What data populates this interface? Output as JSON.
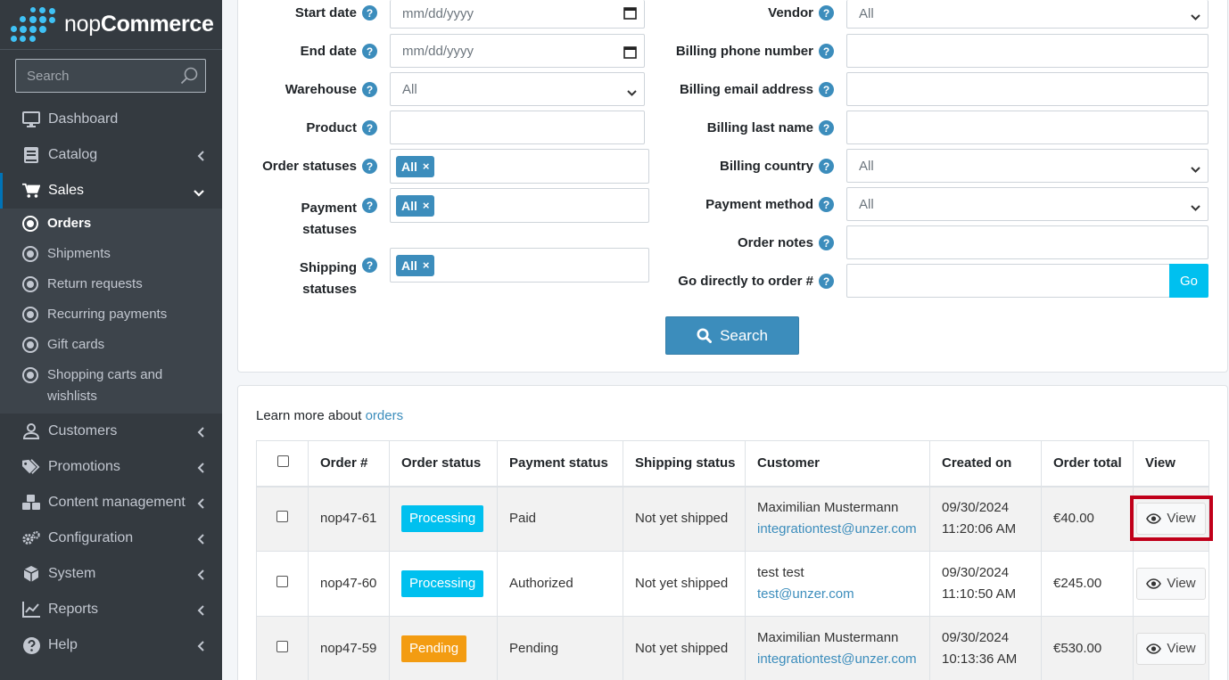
{
  "brand": {
    "prefix": "nop",
    "suffix": "Commerce"
  },
  "sidebar": {
    "search_placeholder": "Search",
    "items": [
      {
        "label": "Dashboard"
      },
      {
        "label": "Catalog"
      },
      {
        "label": "Sales"
      },
      {
        "label": "Customers"
      },
      {
        "label": "Promotions"
      },
      {
        "label": "Content management"
      },
      {
        "label": "Configuration"
      },
      {
        "label": "System"
      },
      {
        "label": "Reports"
      },
      {
        "label": "Help"
      }
    ],
    "sales_sub": [
      {
        "label": "Orders"
      },
      {
        "label": "Shipments"
      },
      {
        "label": "Return requests"
      },
      {
        "label": "Recurring payments"
      },
      {
        "label": "Gift cards"
      },
      {
        "label": "Shopping carts and wishlists"
      }
    ]
  },
  "filters": {
    "left": [
      {
        "label": "Start date",
        "value": "mm/dd/yyyy"
      },
      {
        "label": "End date",
        "value": "mm/dd/yyyy"
      },
      {
        "label": "Warehouse",
        "value": "All"
      },
      {
        "label": "Product",
        "value": ""
      },
      {
        "label": "Order statuses",
        "value": "All"
      },
      {
        "label": "Payment statuses",
        "value": "All"
      },
      {
        "label": "Shipping statuses",
        "value": "All"
      }
    ],
    "right": [
      {
        "label": "Vendor",
        "value": "All"
      },
      {
        "label": "Billing phone number",
        "value": ""
      },
      {
        "label": "Billing email address",
        "value": ""
      },
      {
        "label": "Billing last name",
        "value": ""
      },
      {
        "label": "Billing country",
        "value": "All"
      },
      {
        "label": "Payment method",
        "value": "All"
      },
      {
        "label": "Order notes",
        "value": ""
      },
      {
        "label": "Go directly to order #",
        "value": ""
      }
    ],
    "help_glyph": "?",
    "tag_remove": "×",
    "go_label": "Go",
    "search_label": "Search"
  },
  "orders": {
    "learn_prefix": "Learn more about ",
    "learn_link": "orders",
    "columns": [
      "Order #",
      "Order status",
      "Payment status",
      "Shipping status",
      "Customer",
      "Created on",
      "Order total",
      "View"
    ],
    "rows": [
      {
        "order": "nop47-61",
        "status": "Processing",
        "payment": "Paid",
        "shipping": "Not yet shipped",
        "name": "Maximilian Mustermann",
        "email": "integrationtest@unzer.com",
        "date": "09/30/2024",
        "time": "11:20:06 AM",
        "total": "€40.00",
        "view": "View"
      },
      {
        "order": "nop47-60",
        "status": "Processing",
        "payment": "Authorized",
        "shipping": "Not yet shipped",
        "name": "test test",
        "email": "test@unzer.com",
        "date": "09/30/2024",
        "time": "11:10:50 AM",
        "total": "€245.00",
        "view": "View"
      },
      {
        "order": "nop47-59",
        "status": "Pending",
        "payment": "Pending",
        "shipping": "Not yet shipped",
        "name": "Maximilian Mustermann",
        "email": "integrationtest@unzer.com",
        "date": "09/30/2024",
        "time": "10:13:36 AM",
        "total": "€530.00",
        "view": "View"
      }
    ]
  },
  "colors": {
    "sidebar": "#343a40",
    "accent": "#3c8dbc",
    "info": "#00c0ef",
    "warning": "#f39c12",
    "highlight": "#c0001a"
  }
}
